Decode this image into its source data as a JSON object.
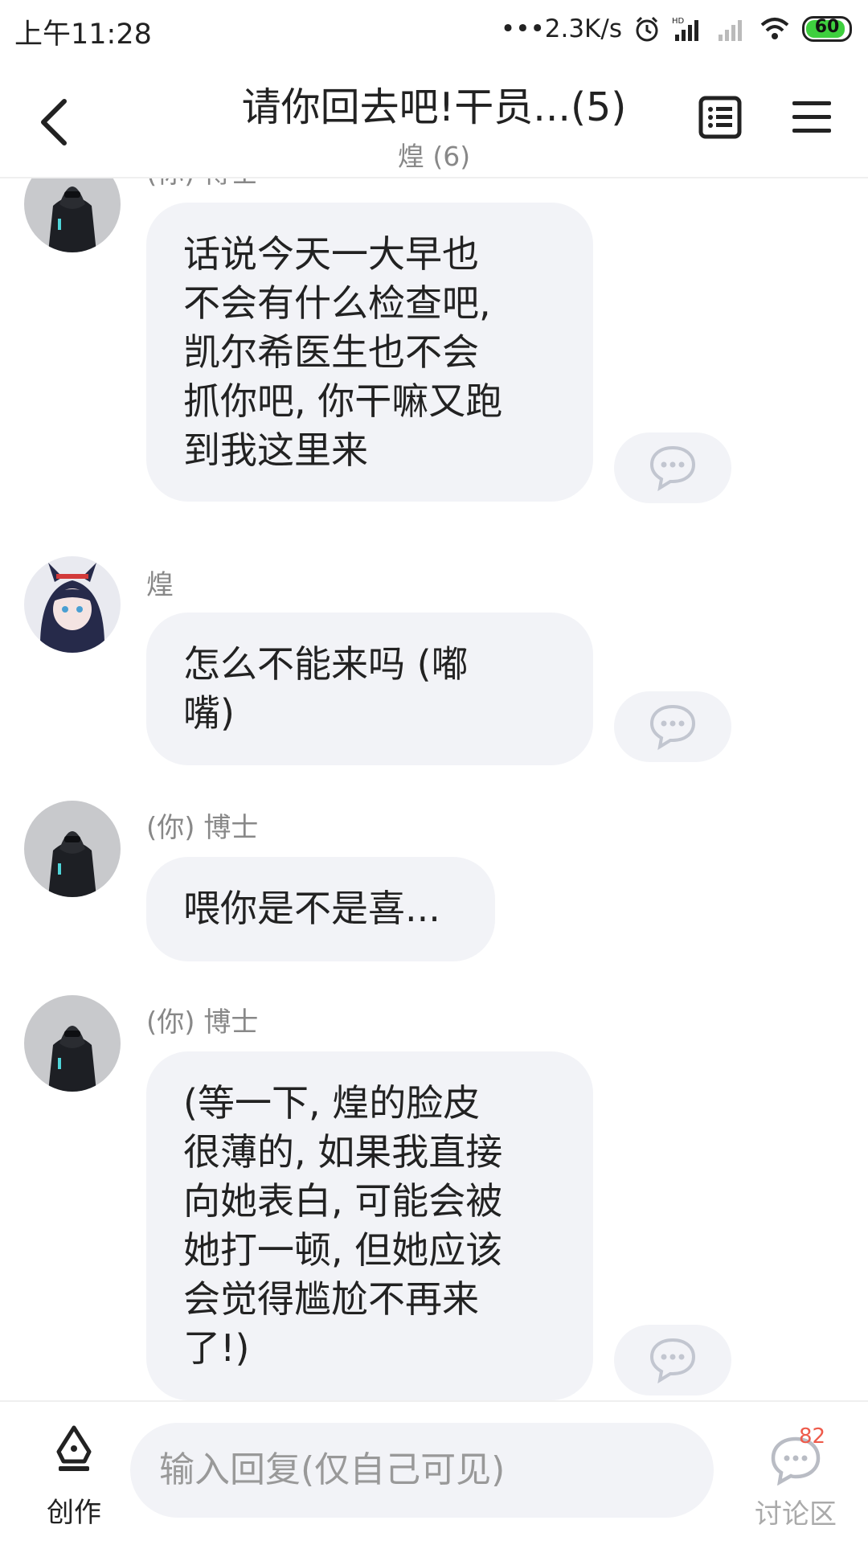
{
  "status_bar": {
    "time": "上午11:28",
    "network_speed": "•••2.3K/s",
    "battery": "60"
  },
  "header": {
    "title": "请你回去吧!干员...(5)",
    "subtitle": "煌 (6)"
  },
  "messages": [
    {
      "sender": "(你) 博士",
      "text_lines": [
        "话说今天一大早也",
        "不会有什么检查吧,",
        "凯尔希医生也不会",
        "抓你吧, 你干嘛又跑",
        "到我这里来"
      ]
    },
    {
      "sender": "煌",
      "text_lines": [
        "怎么不能来吗 (嘟",
        "嘴)"
      ]
    },
    {
      "sender": "(你) 博士",
      "text_lines": [
        "喂你是不是喜..."
      ]
    },
    {
      "sender": "(你) 博士",
      "text_lines": [
        "(等一下, 煌的脸皮",
        "很薄的, 如果我直接",
        "向她表白, 可能会被",
        "她打一顿, 但她应该",
        "会觉得尴尬不再来",
        "了!)"
      ]
    }
  ],
  "bottom_bar": {
    "create_label": "创作",
    "input_placeholder": "输入回复(仅自己可见)",
    "discuss_label": "讨论区",
    "discuss_badge": "82"
  }
}
